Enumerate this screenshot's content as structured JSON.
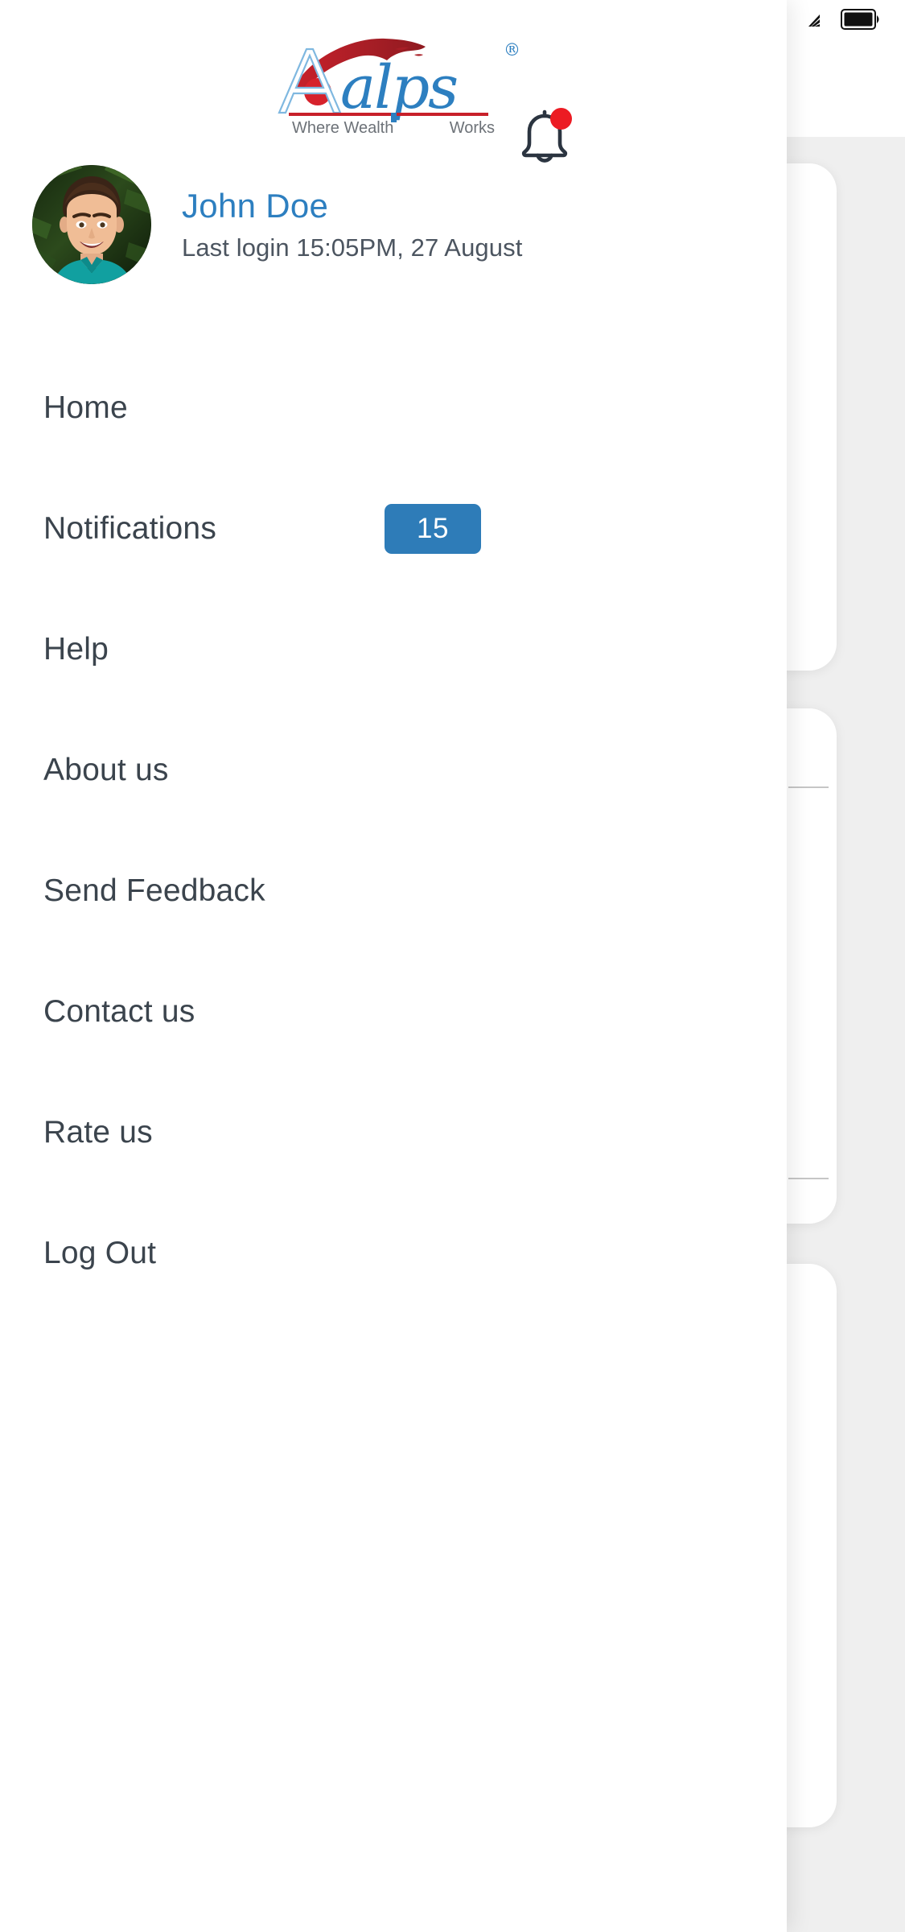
{
  "statusbar": {
    "wifi_icon": "wifi-icon",
    "battery_icon": "battery-full-icon"
  },
  "brand": {
    "name": "Aalps",
    "letter_a": "A",
    "wordmark": "alps",
    "tagline_left": "Where Wealth",
    "tagline_right": "Works",
    "registered_mark": "®",
    "blue": "#2d7fc0",
    "red": "#b5232b",
    "tagline_color": "#6d7278"
  },
  "header": {
    "bell_icon": "notification-bell-icon",
    "bell_has_unread": true,
    "bell_dot_color": "#ec1b23"
  },
  "profile": {
    "avatar_icon": "user-avatar-photo",
    "name": "John Doe",
    "last_login": "Last login 15:05PM, 27 August",
    "name_color": "#2d7fc0",
    "login_color": "#4c5560"
  },
  "menu": {
    "items": [
      {
        "label": "Home",
        "badge": null
      },
      {
        "label": "Notifications",
        "badge": "15"
      },
      {
        "label": "Help",
        "badge": null
      },
      {
        "label": "About us",
        "badge": null
      },
      {
        "label": "Send Feedback",
        "badge": null
      },
      {
        "label": "Contact us",
        "badge": null
      },
      {
        "label": "Rate us",
        "badge": null
      },
      {
        "label": "Log Out",
        "badge": null
      }
    ],
    "badge_bg": "#2e7cb8",
    "badge_text_color": "#ffffff",
    "label_color": "#3b444d"
  },
  "background_app": {
    "panel_color": "#efefef",
    "card_color": "#ffffff"
  }
}
